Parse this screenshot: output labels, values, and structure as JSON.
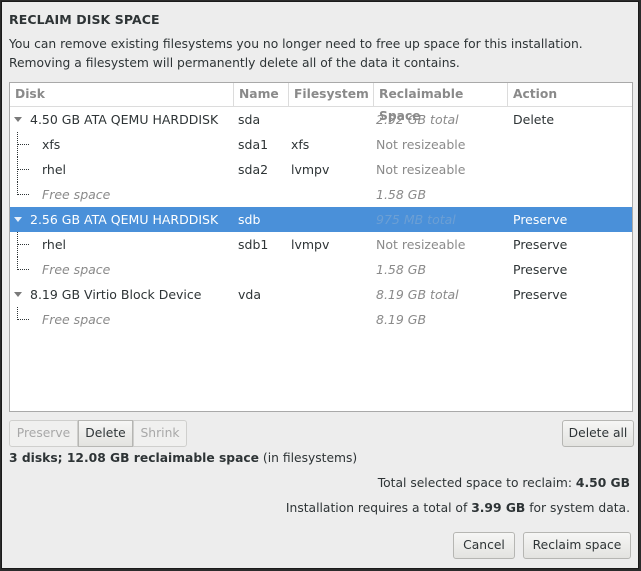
{
  "dialog": {
    "title": "RECLAIM DISK SPACE",
    "description_line1": "You can remove existing filesystems you no longer need to free up space for this installation.",
    "description_line2": "Removing a filesystem will permanently delete all of the data it contains."
  },
  "table": {
    "columns": [
      "Disk",
      "Name",
      "Filesystem",
      "Reclaimable Space",
      "Action"
    ],
    "rows": [
      {
        "disk": "4.50 GB ATA QEMU HARDDISK",
        "name": "sda",
        "filesystem": "",
        "reclaimable": "2.92 GB total",
        "action": "Delete",
        "level": 0,
        "selected": false
      },
      {
        "disk": "xfs",
        "name": "sda1",
        "filesystem": "xfs",
        "reclaimable": "Not resizeable",
        "action": "",
        "level": 1
      },
      {
        "disk": "rhel",
        "name": "sda2",
        "filesystem": "lvmpv",
        "reclaimable": "Not resizeable",
        "action": "",
        "level": 1
      },
      {
        "disk": "Free space",
        "name": "",
        "filesystem": "",
        "reclaimable": "1.58 GB",
        "action": "",
        "level": 1,
        "free": true
      },
      {
        "disk": "2.56 GB ATA QEMU HARDDISK",
        "name": "sdb",
        "filesystem": "",
        "reclaimable": "975 MB total",
        "action": "Preserve",
        "level": 0,
        "selected": true
      },
      {
        "disk": "rhel",
        "name": "sdb1",
        "filesystem": "lvmpv",
        "reclaimable": "Not resizeable",
        "action": "Preserve",
        "level": 1
      },
      {
        "disk": "Free space",
        "name": "",
        "filesystem": "",
        "reclaimable": "1.58 GB",
        "action": "Preserve",
        "level": 1,
        "free": true
      },
      {
        "disk": "8.19 GB Virtio Block Device",
        "name": "vda",
        "filesystem": "",
        "reclaimable": "8.19 GB total",
        "action": "Preserve",
        "level": 0
      },
      {
        "disk": "Free space",
        "name": "",
        "filesystem": "",
        "reclaimable": "8.19 GB",
        "action": "",
        "level": 1,
        "free": true
      }
    ]
  },
  "buttons": {
    "preserve": "Preserve",
    "delete": "Delete",
    "shrink": "Shrink",
    "delete_all": "Delete all",
    "cancel": "Cancel",
    "reclaim": "Reclaim space"
  },
  "summary": {
    "bold": "3 disks; 12.08 GB reclaimable space",
    "suffix": " (in filesystems)"
  },
  "totals": {
    "selected_label": "Total selected space to reclaim: ",
    "selected_value": "4.50 GB",
    "req_prefix": "Installation requires a total of ",
    "req_value": "3.99 GB",
    "req_suffix": " for system data."
  },
  "colors": {
    "selection": "#4a90d9"
  }
}
